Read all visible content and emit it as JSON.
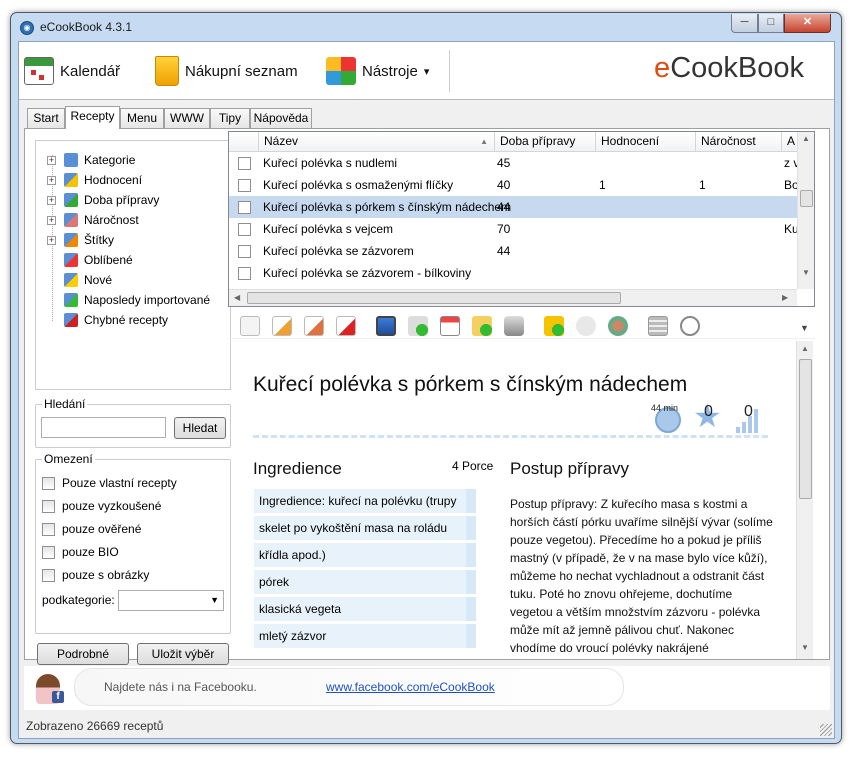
{
  "window": {
    "title": "eCookBook 4.3.1",
    "min": "─",
    "max": "□",
    "close": "✕"
  },
  "toolbar": {
    "items": [
      {
        "label": "Kalendář",
        "icon": "calendar-icon"
      },
      {
        "label": "Nákupní seznam",
        "icon": "shopping-bag-icon"
      },
      {
        "label": "Nástroje",
        "icon": "tools-icon"
      }
    ],
    "nastroje_arrow": "▾",
    "brand_e": "e",
    "brand_rest": "CookBook"
  },
  "tabs": [
    "Start",
    "Recepty",
    "Menu",
    "WWW",
    "Tipy",
    "Nápověda"
  ],
  "tree": [
    {
      "label": "Kategorie",
      "expandable": true
    },
    {
      "label": "Hodnocení",
      "expandable": true
    },
    {
      "label": "Doba přípravy",
      "expandable": true
    },
    {
      "label": "Náročnost",
      "expandable": true
    },
    {
      "label": "Štítky",
      "expandable": true
    },
    {
      "label": "Oblíbené",
      "expandable": false
    },
    {
      "label": "Nové",
      "expandable": false
    },
    {
      "label": "Naposledy importované",
      "expandable": false
    },
    {
      "label": "Chybné recepty",
      "expandable": false
    }
  ],
  "search": {
    "title": "Hledání",
    "value": "",
    "button": "Hledat"
  },
  "filters": {
    "title": "Omezení",
    "items": [
      "Pouze vlastní recepty",
      "pouze vyzkoušené",
      "pouze ověřené",
      "pouze BIO",
      "pouze s obrázky"
    ],
    "subcategory_label": "podkategorie:",
    "subcategory_value": ""
  },
  "buttons": {
    "detail": "Podrobné",
    "save": "Uložit výběr"
  },
  "grid": {
    "columns": [
      "Název",
      "Doba přípravy",
      "Hodnocení",
      "Náročnost",
      "A"
    ],
    "sort_arrow": "▲",
    "rows": [
      {
        "name": "Kuřecí polévka s nudlemi",
        "time": "45",
        "rating": "",
        "difficulty": "",
        "a": "z v"
      },
      {
        "name": "Kuřecí polévka s osmaženými flíčky",
        "time": "40",
        "rating": "1",
        "difficulty": "1",
        "a": "Bo"
      },
      {
        "name": "Kuřecí polévka s pórkem s čínským nádechem",
        "time": "44",
        "rating": "",
        "difficulty": "",
        "a": ""
      },
      {
        "name": "Kuřecí polévka s vejcem",
        "time": "70",
        "rating": "",
        "difficulty": "",
        "a": "Ku"
      },
      {
        "name": "Kuřecí polévka se zázvorem",
        "time": "44",
        "rating": "",
        "difficulty": "",
        "a": ""
      },
      {
        "name": "Kuřecí polévka se zázvorem - bílkoviny",
        "time": "",
        "rating": "",
        "difficulty": "",
        "a": ""
      }
    ],
    "selected_index": 2
  },
  "recipe": {
    "title": "Kuřecí polévka s pórkem s čínským nádechem",
    "time": "44 min",
    "rating": "0",
    "difficulty": "0",
    "ingredients_title": "Ingredience",
    "portions": "4 Porce",
    "ingredients": [
      "Ingredience: kuřecí na polévku (trupy",
      "skelet po vykoštění masa na roládu",
      "křídla apod.)",
      "pórek",
      "klasická vegeta",
      "mletý zázvor"
    ],
    "procedure_title": "Postup přípravy",
    "procedure": "Postup přípravy: Z kuřecího masa s kostmi a horších částí pórku uvaříme silnější vývar (solíme pouze vegetou). Přecedíme ho a pokud je příliš mastný (v případě, že v na mase bylo více kůží), můžeme ho nechat vychladnout a odstranit část tuku. Poté ho znovu ohřejeme, dochutíme vegetou a větším množstvím zázvoru - polévka může mít až jemně pálivou chuť. Nakonec vhodíme do vroucí polévky nakrájené"
  },
  "facebook": {
    "text": "Najdete nás i na Facebooku.",
    "link": "www.facebook.com/eCookBook"
  },
  "status": "Zobrazeno 26669 receptů",
  "colors": {
    "selection": "#c6d9ef",
    "brand_e": "#e24a13",
    "window_frame": "#c6dbf1"
  }
}
